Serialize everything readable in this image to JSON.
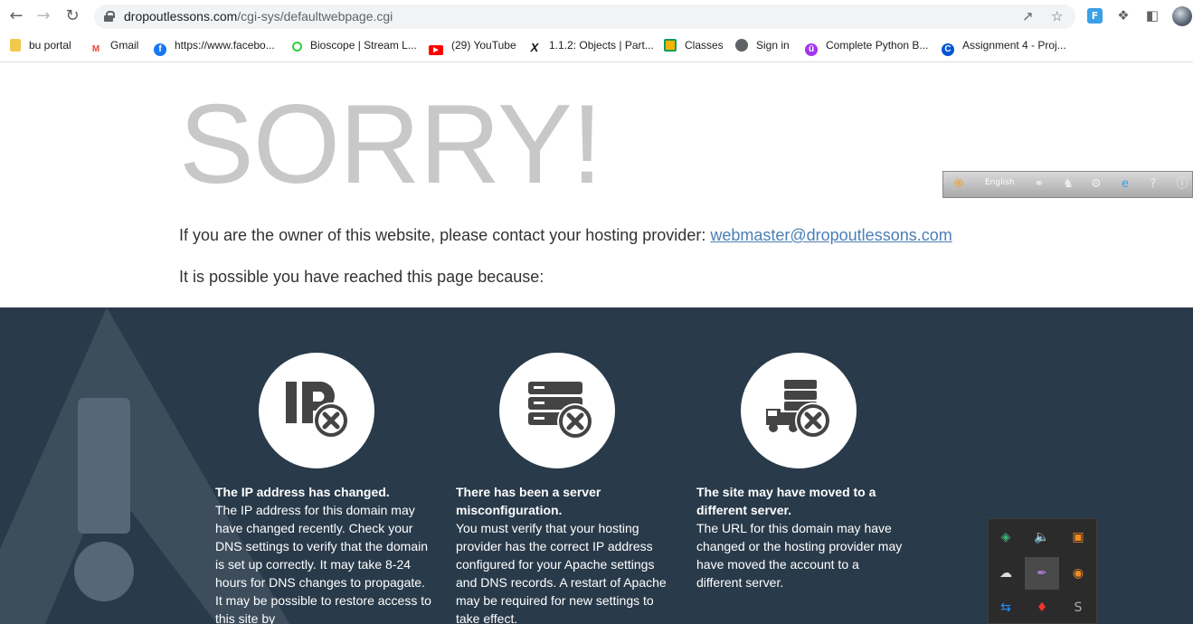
{
  "browser": {
    "url_domain": "dropoutlessons.com",
    "url_path": "/cgi-sys/defaultwebpage.cgi",
    "extension_badge": "F",
    "bookmarks": [
      {
        "label": "bu portal",
        "icon": "folder-icon",
        "color": "#f2c94c"
      },
      {
        "label": "Gmail",
        "icon": "gmail-icon",
        "color": "#ea4335"
      },
      {
        "label": "https://www.facebo...",
        "icon": "facebook-icon",
        "color": "#1877f2"
      },
      {
        "label": "Bioscope | Stream L...",
        "icon": "bioscope-icon",
        "color": "#2ecc40"
      },
      {
        "label": "(29) YouTube",
        "icon": "youtube-icon",
        "color": "#ff0000"
      },
      {
        "label": "1.1.2: Objects | Part...",
        "icon": "edx-icon",
        "color": "#111111"
      },
      {
        "label": "Classes",
        "icon": "classroom-icon",
        "color": "#f4b400"
      },
      {
        "label": "Sign in",
        "icon": "globe-icon",
        "color": "#5f6368"
      },
      {
        "label": "Complete Python B...",
        "icon": "udemy-icon",
        "color": "#a435f0"
      },
      {
        "label": "Assignment 4 - Proj...",
        "icon": "coursera-icon",
        "color": "#0056d2"
      }
    ]
  },
  "page": {
    "headline": "SORRY!",
    "owner_text": "If you are the owner of this website, please contact your hosting provider: ",
    "owner_email": "webmaster@dropoutlessons.com",
    "reason_intro": "It is possible you have reached this page because:",
    "reasons": [
      {
        "icon": "ip-error-icon",
        "title": "The IP address has changed.",
        "body": "The IP address for this domain may have changed recently. Check your DNS settings to verify that the domain is set up correctly. It may take 8-24 hours for DNS changes to propagate. It may be possible to restore access to this site by"
      },
      {
        "icon": "server-error-icon",
        "title": "There has been a server misconfiguration.",
        "body": "You must verify that your hosting provider has the correct IP address configured for your Apache settings and DNS records. A restart of Apache may be required for new settings to take effect."
      },
      {
        "icon": "moved-server-icon",
        "title": "The site may have moved to a different server.",
        "body": "The URL for this domain may have changed or the hosting provider may have moved the account to a different server."
      }
    ]
  },
  "ime_toolbar": {
    "language": "English"
  },
  "colors": {
    "dark_band": "#293a4a",
    "headline": "#c8c8c8",
    "link": "#4a7fb5",
    "icon_dark": "#444444"
  }
}
